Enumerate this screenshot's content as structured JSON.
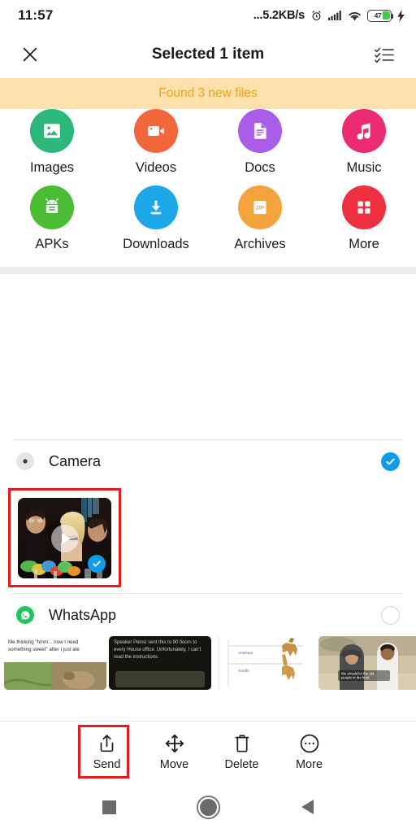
{
  "status_bar": {
    "time": "11:57",
    "network_speed": "...5.2KB/s",
    "alarm_icon": "alarm-clock-icon",
    "signal_icon": "cellular-signal-icon",
    "wifi_icon": "wifi-icon",
    "battery_percent": "47",
    "charging_icon": "charging-bolt-icon",
    "battery_color": "#3ecf4a"
  },
  "header": {
    "close_label": "close-icon",
    "title": "Selected 1 item",
    "select_all_label": "select-all-icon"
  },
  "banner": {
    "text": "Found 3 new files",
    "bg_color": "#fce1ad",
    "text_color": "#e8a317"
  },
  "categories": [
    {
      "label": "Images",
      "icon": "image-icon",
      "color": "#2bb87a"
    },
    {
      "label": "Videos",
      "icon": "video-icon",
      "color": "#f2663c"
    },
    {
      "label": "Docs",
      "icon": "document-icon",
      "color": "#a95de8"
    },
    {
      "label": "Music",
      "icon": "music-note-icon",
      "color": "#ec2c70"
    },
    {
      "label": "APKs",
      "icon": "android-icon",
      "color": "#4bbd35"
    },
    {
      "label": "Downloads",
      "icon": "download-icon",
      "color": "#1ba7e8"
    },
    {
      "label": "Archives",
      "icon": "zip-icon",
      "color": "#f2a33c",
      "badge": "ZIP"
    },
    {
      "label": "More",
      "icon": "grid-icon",
      "color": "#ef3043"
    }
  ],
  "groups": [
    {
      "name": "Camera",
      "icon": "camera-folder-icon",
      "selected": true,
      "check_color": "#0c9ceb",
      "items": [
        {
          "type": "video",
          "selected": true,
          "play_icon": "play-icon",
          "check_icon": "check-icon"
        }
      ]
    },
    {
      "name": "WhatsApp",
      "icon": "whatsapp-icon",
      "selected": false,
      "items": [
        {
          "type": "image",
          "caption": "Me thinking \"hmm... now I need something sweet\" after I just ate"
        },
        {
          "type": "image",
          "caption": "Speaker Pelosi sent this to 90 floors to every House office. Unfortunately, I can't read the instructions."
        },
        {
          "type": "image",
          "caption": "Antelope / Giraffe chart"
        },
        {
          "type": "image",
          "caption": "We should let the old people in the front"
        }
      ]
    }
  ],
  "actions": [
    {
      "label": "Send",
      "icon": "share-icon",
      "highlighted": true
    },
    {
      "label": "Move",
      "icon": "move-icon",
      "highlighted": false
    },
    {
      "label": "Delete",
      "icon": "trash-icon",
      "highlighted": false
    },
    {
      "label": "More",
      "icon": "more-dots-icon",
      "highlighted": false
    }
  ],
  "nav_bar": {
    "recents": "recents-square-icon",
    "home": "home-circle-icon",
    "back": "back-triangle-icon"
  },
  "highlight_color": "#e31b23"
}
